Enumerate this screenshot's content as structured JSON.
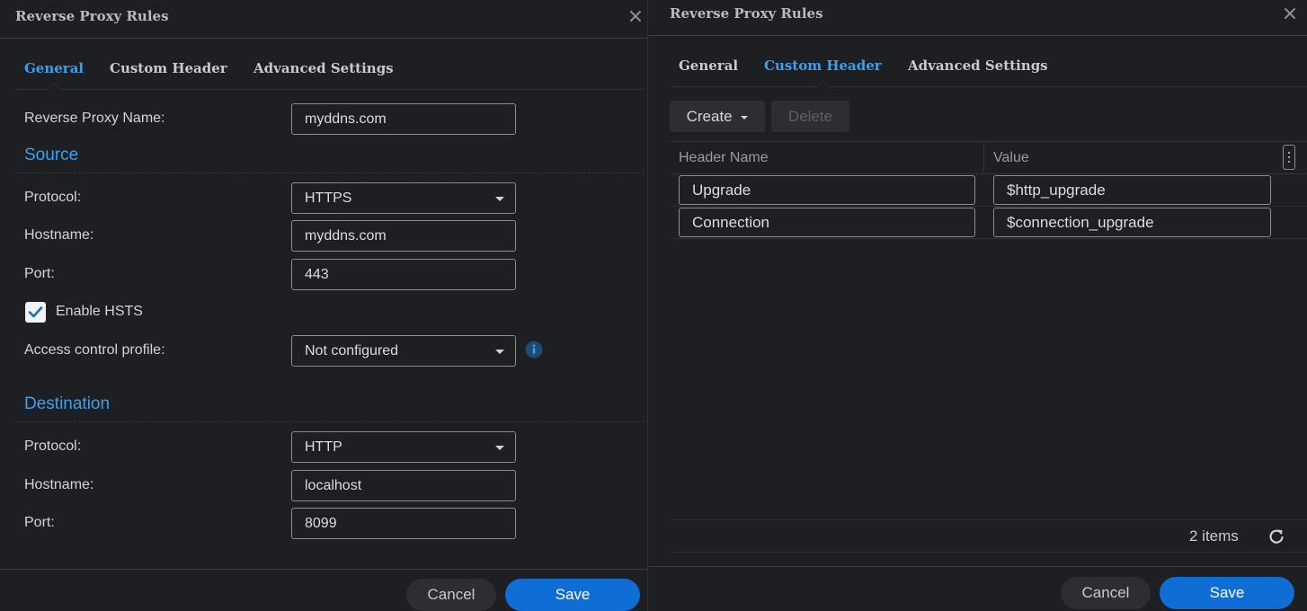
{
  "left_dialog": {
    "title": "Reverse Proxy Rules",
    "tabs": [
      {
        "label": "General",
        "active": true
      },
      {
        "label": "Custom Header",
        "active": false
      },
      {
        "label": "Advanced Settings",
        "active": false
      }
    ],
    "reverse_proxy_name": {
      "label": "Reverse Proxy Name:",
      "value": "myddns.com"
    },
    "source": {
      "title": "Source",
      "protocol": {
        "label": "Protocol:",
        "value": "HTTPS"
      },
      "hostname": {
        "label": "Hostname:",
        "value": "myddns.com"
      },
      "port": {
        "label": "Port:",
        "value": "443"
      },
      "enable_hsts": {
        "label": "Enable HSTS",
        "checked": true
      },
      "access_control_profile": {
        "label": "Access control profile:",
        "value": "Not configured"
      }
    },
    "destination": {
      "title": "Destination",
      "protocol": {
        "label": "Protocol:",
        "value": "HTTP"
      },
      "hostname": {
        "label": "Hostname:",
        "value": "localhost"
      },
      "port": {
        "label": "Port:",
        "value": "8099"
      }
    },
    "footer": {
      "cancel_label": "Cancel",
      "save_label": "Save"
    }
  },
  "right_dialog": {
    "title": "Reverse Proxy Rules",
    "tabs": [
      {
        "label": "General",
        "active": false
      },
      {
        "label": "Custom Header",
        "active": true
      },
      {
        "label": "Advanced Settings",
        "active": false
      }
    ],
    "toolbar": {
      "create_label": "Create",
      "delete_label": "Delete"
    },
    "table": {
      "columns": [
        "Header Name",
        "Value"
      ],
      "rows": [
        {
          "header_name": "Upgrade",
          "value": "$http_upgrade"
        },
        {
          "header_name": "Connection",
          "value": "$connection_upgrade"
        }
      ]
    },
    "items_count": "2 items",
    "footer": {
      "cancel_label": "Cancel",
      "save_label": "Save"
    }
  },
  "colors": {
    "accent": "#3aa0f2",
    "primary_button": "#0f6ed6",
    "background": "#1e1f22",
    "text": "#d8d9db"
  },
  "icons": [
    "close-icon",
    "info-icon",
    "check-icon",
    "chevron-down-icon",
    "caret-down-icon",
    "column-menu-icon",
    "refresh-icon"
  ]
}
